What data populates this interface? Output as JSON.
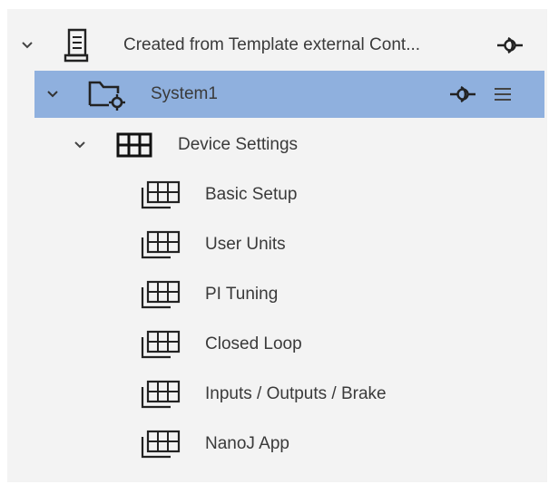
{
  "tree": {
    "root": {
      "label": "Created from Template external Cont...",
      "icon": "document-icon",
      "action_icon": "link-node-icon"
    },
    "system": {
      "label": "System1",
      "icon": "folder-gear-icon",
      "action_icon": "link-node-icon",
      "menu_icon": "hamburger-icon"
    },
    "device_settings": {
      "label": "Device Settings",
      "icon": "grid-icon"
    },
    "children": [
      {
        "label": "Basic Setup",
        "icon": "table-stack-icon"
      },
      {
        "label": "User Units",
        "icon": "table-stack-icon"
      },
      {
        "label": "PI Tuning",
        "icon": "table-stack-icon"
      },
      {
        "label": "Closed Loop",
        "icon": "table-stack-icon"
      },
      {
        "label": "Inputs / Outputs / Brake",
        "icon": "table-stack-icon"
      },
      {
        "label": "NanoJ App",
        "icon": "table-stack-icon"
      }
    ]
  },
  "colors": {
    "panel_bg": "#f3f3f3",
    "selected_bg": "#8fb0de",
    "text": "#3a3a3a",
    "icon": "#222222"
  }
}
